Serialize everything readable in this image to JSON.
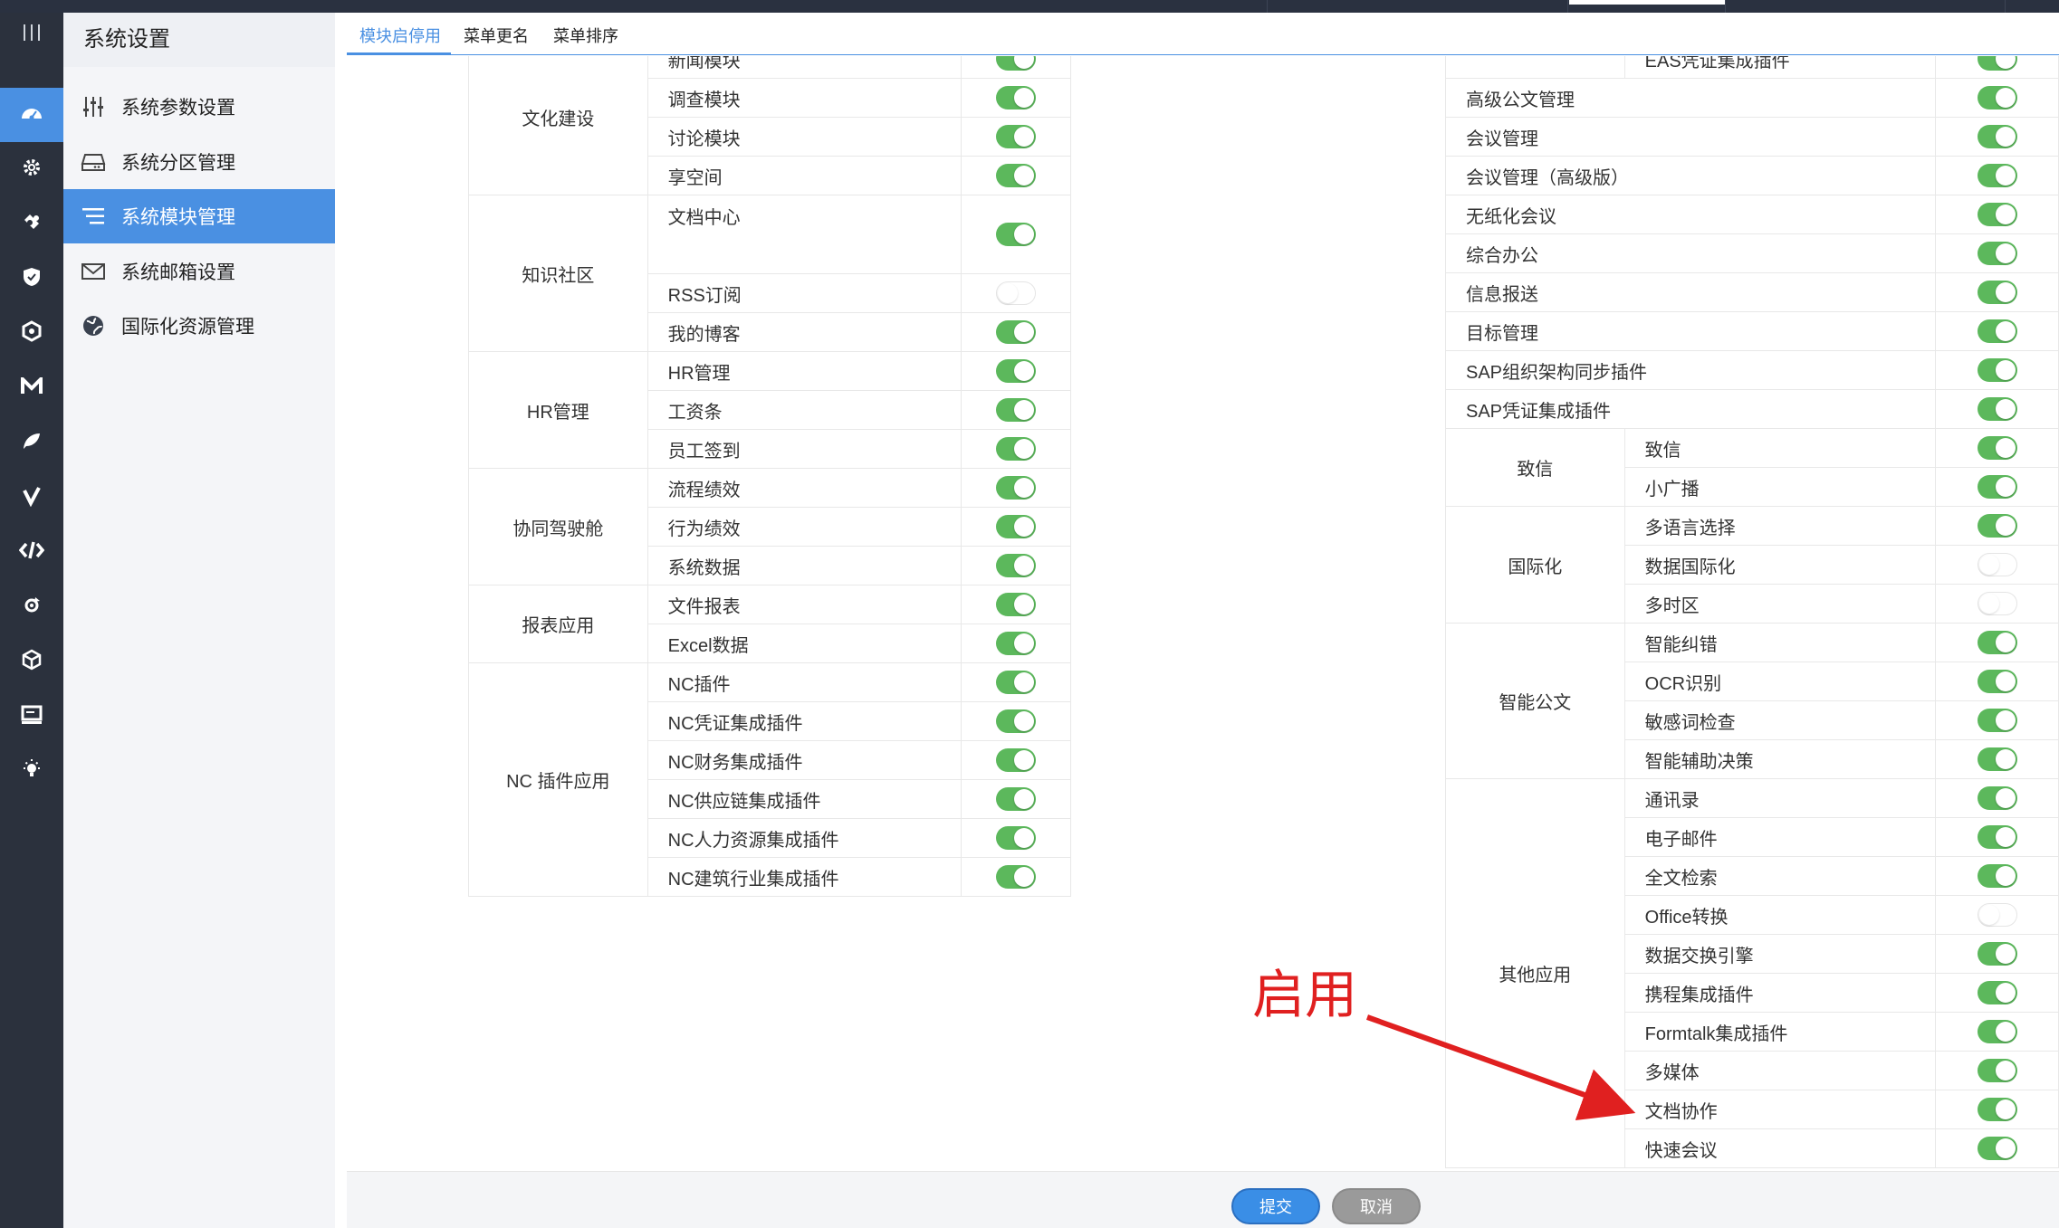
{
  "colors": {
    "accent": "#4a90e2",
    "switch_on": "#5cb85c",
    "annotation": "#e02020",
    "sidebar_dark": "#2b313d"
  },
  "iconbar": {
    "items": [
      {
        "icon": "menu-lines-icon",
        "active": false
      },
      {
        "icon": "dashboard-icon",
        "active": true
      },
      {
        "icon": "gear-icon",
        "active": false
      },
      {
        "icon": "puzzle-icon",
        "active": false
      },
      {
        "icon": "shield-icon",
        "active": false
      },
      {
        "icon": "hexagon-icon",
        "active": false
      },
      {
        "icon": "m-letter-icon",
        "active": false
      },
      {
        "icon": "leaf-icon",
        "active": false
      },
      {
        "icon": "check-v-icon",
        "active": false
      },
      {
        "icon": "code-icon",
        "active": false
      },
      {
        "icon": "process-icon",
        "active": false
      },
      {
        "icon": "cube-icon",
        "active": false
      },
      {
        "icon": "monitor-icon",
        "active": false
      },
      {
        "icon": "bulb-icon",
        "active": false
      }
    ]
  },
  "sidemenu": {
    "title": "系统设置",
    "items": [
      {
        "label": "系统参数设置",
        "icon": "sliders-icon",
        "active": false
      },
      {
        "label": "系统分区管理",
        "icon": "drive-icon",
        "active": false
      },
      {
        "label": "系统模块管理",
        "icon": "list-icon",
        "active": true
      },
      {
        "label": "系统邮箱设置",
        "icon": "mail-icon",
        "active": false
      },
      {
        "label": "国际化资源管理",
        "icon": "globe-icon",
        "active": false
      }
    ]
  },
  "tabs": [
    {
      "label": "模块启停用",
      "active": true
    },
    {
      "label": "菜单更名",
      "active": false
    },
    {
      "label": "菜单排序",
      "active": false
    }
  ],
  "left_table": [
    {
      "group": "文化建设",
      "modules": [
        {
          "name": "新闻模块",
          "on": true
        },
        {
          "name": "调查模块",
          "on": true
        },
        {
          "name": "讨论模块",
          "on": true
        },
        {
          "name": "享空间",
          "on": true
        }
      ]
    },
    {
      "group": "知识社区",
      "modules": [
        {
          "name": "文档中心",
          "on": true
        },
        {
          "name": "RSS订阅",
          "on": false
        },
        {
          "name": "我的博客",
          "on": true
        }
      ]
    },
    {
      "group": "HR管理",
      "modules": [
        {
          "name": "HR管理",
          "on": true
        },
        {
          "name": "工资条",
          "on": true
        },
        {
          "name": "员工签到",
          "on": true
        }
      ]
    },
    {
      "group": "协同驾驶舱",
      "modules": [
        {
          "name": "流程绩效",
          "on": true
        },
        {
          "name": "行为绩效",
          "on": true
        },
        {
          "name": "系统数据",
          "on": true
        }
      ]
    },
    {
      "group": "报表应用",
      "modules": [
        {
          "name": "文件报表",
          "on": true
        },
        {
          "name": "Excel数据",
          "on": true
        }
      ]
    },
    {
      "group": "NC 插件应用",
      "modules": [
        {
          "name": "NC插件",
          "on": true
        },
        {
          "name": "NC凭证集成插件",
          "on": true
        },
        {
          "name": "NC财务集成插件",
          "on": true
        },
        {
          "name": "NC供应链集成插件",
          "on": true
        },
        {
          "name": "NC人力资源集成插件",
          "on": true
        },
        {
          "name": "NC建筑行业集成插件",
          "on": true
        }
      ]
    }
  ],
  "right_partial_top": {
    "name": "EAS凭证集成插件",
    "on": true
  },
  "right_single": [
    {
      "name": "高级公文管理",
      "on": true
    },
    {
      "name": "会议管理",
      "on": true
    },
    {
      "name": "会议管理（高级版）",
      "on": true
    },
    {
      "name": "无纸化会议",
      "on": true
    },
    {
      "name": "综合办公",
      "on": true
    },
    {
      "name": "信息报送",
      "on": true
    },
    {
      "name": "目标管理",
      "on": true
    },
    {
      "name": "SAP组织架构同步插件",
      "on": true
    },
    {
      "name": "SAP凭证集成插件",
      "on": true
    }
  ],
  "right_groups": [
    {
      "group": "致信",
      "modules": [
        {
          "name": "致信",
          "on": true
        },
        {
          "name": "小广播",
          "on": true
        }
      ]
    },
    {
      "group": "国际化",
      "modules": [
        {
          "name": "多语言选择",
          "on": true
        },
        {
          "name": "数据国际化",
          "on": false
        },
        {
          "name": "多时区",
          "on": false
        }
      ]
    },
    {
      "group": "智能公文",
      "modules": [
        {
          "name": "智能纠错",
          "on": true
        },
        {
          "name": "OCR识别",
          "on": true
        },
        {
          "name": "敏感词检查",
          "on": true
        },
        {
          "name": "智能辅助决策",
          "on": true
        }
      ]
    },
    {
      "group": "其他应用",
      "modules": [
        {
          "name": "通讯录",
          "on": true
        },
        {
          "name": "电子邮件",
          "on": true
        },
        {
          "name": "全文检索",
          "on": true
        },
        {
          "name": "Office转换",
          "on": false
        },
        {
          "name": "数据交换引擎",
          "on": true
        },
        {
          "name": "携程集成插件",
          "on": true
        },
        {
          "name": "Formtalk集成插件",
          "on": true
        },
        {
          "name": "多媒体",
          "on": true
        },
        {
          "name": "文档协作",
          "on": true
        },
        {
          "name": "快速会议",
          "on": true
        }
      ]
    }
  ],
  "footer": {
    "submit_label": "提交",
    "cancel_label": "取消"
  },
  "annotation": {
    "text": "启用"
  }
}
